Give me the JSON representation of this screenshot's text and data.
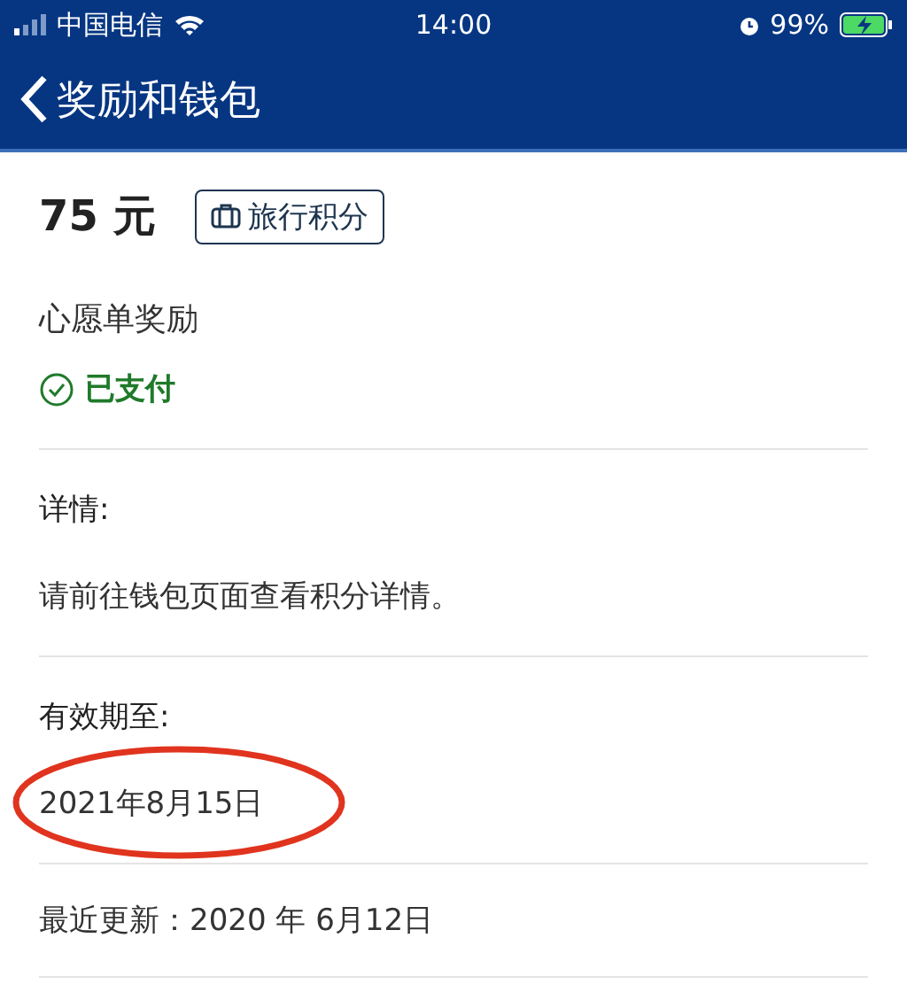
{
  "status_bar": {
    "carrier": "中国电信",
    "time": "14:00",
    "battery": "99%",
    "charging": true
  },
  "nav_bar": {
    "title": "奖励和钱包"
  },
  "reward": {
    "amount": "75 元",
    "tag": "旅行积分",
    "name": "心愿单奖励",
    "status": {
      "label": "已支付",
      "paid": true
    }
  },
  "sections": [
    {
      "label": "详情:",
      "value": "请前往钱包页面查看积分详情。",
      "highlighted": false
    },
    {
      "label": "有效期至:",
      "value": "2021年8月15日",
      "highlighted": true
    }
  ],
  "last_updated": "最近更新：2020 年 6月12日"
}
